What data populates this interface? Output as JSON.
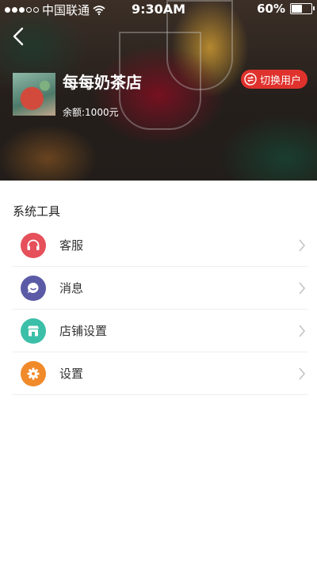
{
  "status_bar": {
    "carrier": "中国联通",
    "time": "9:30AM",
    "battery": "60%",
    "battery_level": 0.6
  },
  "header": {
    "shop_name": "每每奶茶店",
    "balance": "余额:1000元",
    "switch_label": "切换用户"
  },
  "section": {
    "title": "系统工具"
  },
  "menu": [
    {
      "label": "客服",
      "icon": "headset-icon",
      "color": "#e5505a"
    },
    {
      "label": "消息",
      "icon": "chat-icon",
      "color": "#5b5aa6"
    },
    {
      "label": "店铺设置",
      "icon": "store-icon",
      "color": "#3cbfa8"
    },
    {
      "label": "设置",
      "icon": "gear-icon",
      "color": "#f08a2a"
    }
  ]
}
